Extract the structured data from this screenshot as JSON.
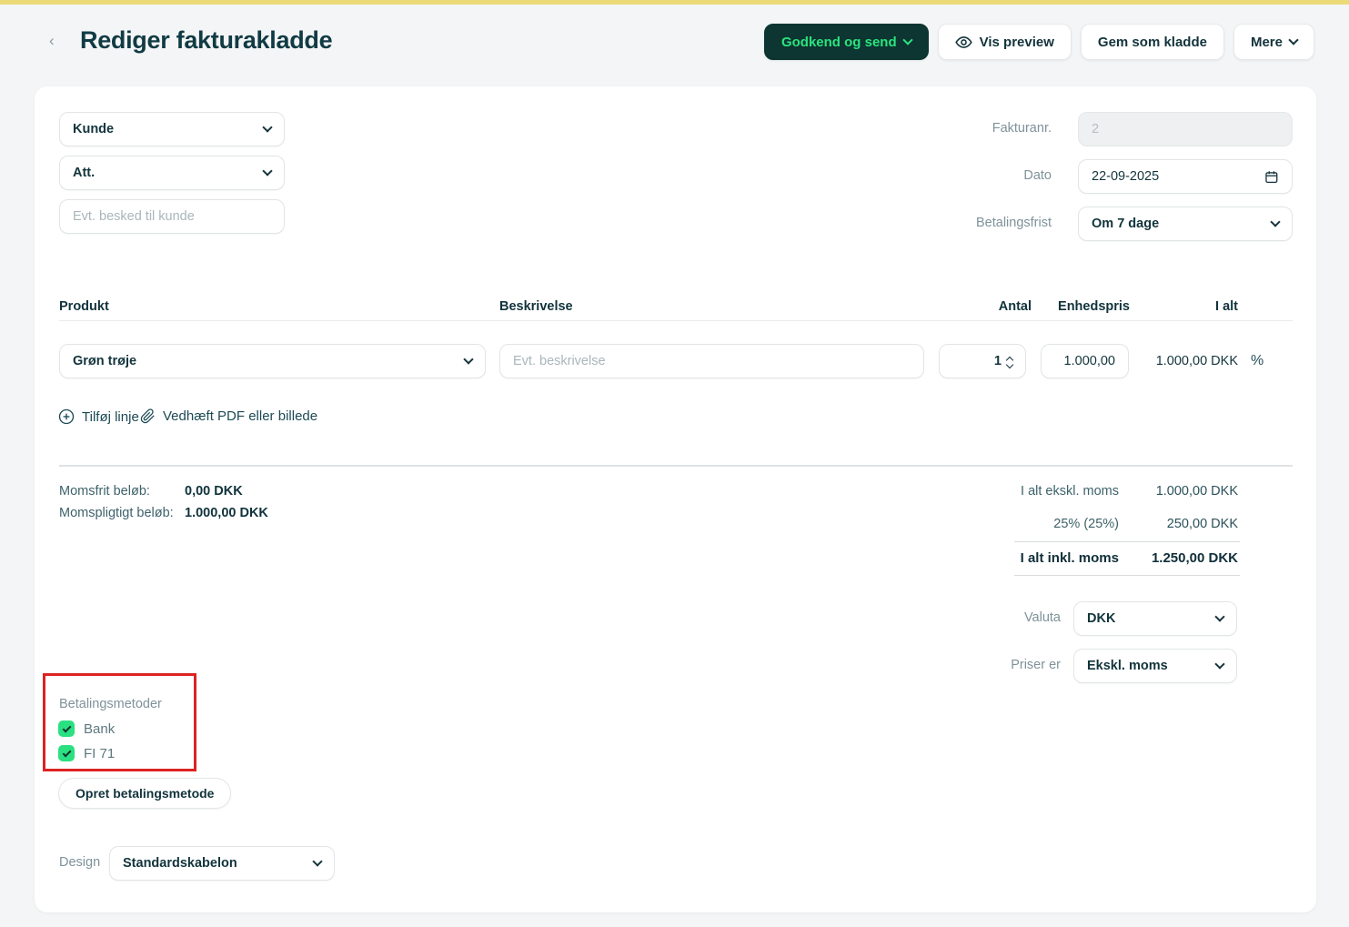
{
  "colors": {
    "accent_green": "#2ae47e",
    "approve_button_bg": "#0d3531",
    "annotation_red": "#dd2222",
    "top_bar_yellow": "#ecd977",
    "title_ink": "#113b44"
  },
  "header": {
    "back_icon": "‹",
    "title": "Rediger fakturakladde",
    "buttons": {
      "approve": "Godkend og send",
      "preview": "Vis preview",
      "save_draft": "Gem som kladde",
      "more": "Mere"
    }
  },
  "customer": {
    "kunde": "Kunde",
    "att": "Att.",
    "message_placeholder": "Evt. besked til kunde"
  },
  "meta": {
    "fakturanr_label": "Fakturanr.",
    "fakturanr_value": "2",
    "dato_label": "Dato",
    "dato_value": "22-09-2025",
    "betalingsfrist_label": "Betalingsfrist",
    "betalingsfrist_value": "Om 7 dage"
  },
  "table": {
    "headers": {
      "produkt": "Produkt",
      "beskrivelse": "Beskrivelse",
      "antal": "Antal",
      "enhedspris": "Enhedspris",
      "ialt": "I alt"
    },
    "row": {
      "produkt": "Grøn trøje",
      "beskrivelse_placeholder": "Evt. beskrivelse",
      "antal": "1",
      "enhedspris": "1.000,00",
      "ialt": "1.000,00 DKK",
      "discount_symbol": "%"
    },
    "add_line": "Tilføj linje",
    "attach_file": "Vedhæft PDF eller billede"
  },
  "totals": {
    "momsfrit_label": "Momsfrit beløb:",
    "momsfrit_value": "0,00 DKK",
    "momspligtigt_label": "Momspligtigt beløb:",
    "momspligtigt_value": "1.000,00 DKK",
    "rows": [
      {
        "label": "I alt ekskl. moms",
        "value": "1.000,00 DKK"
      },
      {
        "label": "25% (25%)",
        "value": "250,00 DKK"
      }
    ],
    "total_label": "I alt inkl. moms",
    "total_value": "1.250,00 DKK"
  },
  "settings": {
    "valuta_label": "Valuta",
    "valuta_value": "DKK",
    "priser_label": "Priser er",
    "priser_value": "Ekskl. moms"
  },
  "payment": {
    "label": "Betalingsmetoder",
    "methods": [
      {
        "label": "Bank",
        "checked": true
      },
      {
        "label": "FI 71",
        "checked": true
      }
    ],
    "create_button": "Opret betalingsmetode"
  },
  "design": {
    "label": "Design",
    "value": "Standardskabelon"
  },
  "icons": {
    "back": "chevron-left",
    "approve_caret": "chevron-down",
    "preview": "eye-icon",
    "more_caret": "chevron-down",
    "date": "calendar-icon",
    "add_line": "plus-circle-icon",
    "attach": "paperclip-icon",
    "quantity": "stepper-arrows",
    "checkbox": "checkmark-icon",
    "select_caret": "chevron-down"
  }
}
